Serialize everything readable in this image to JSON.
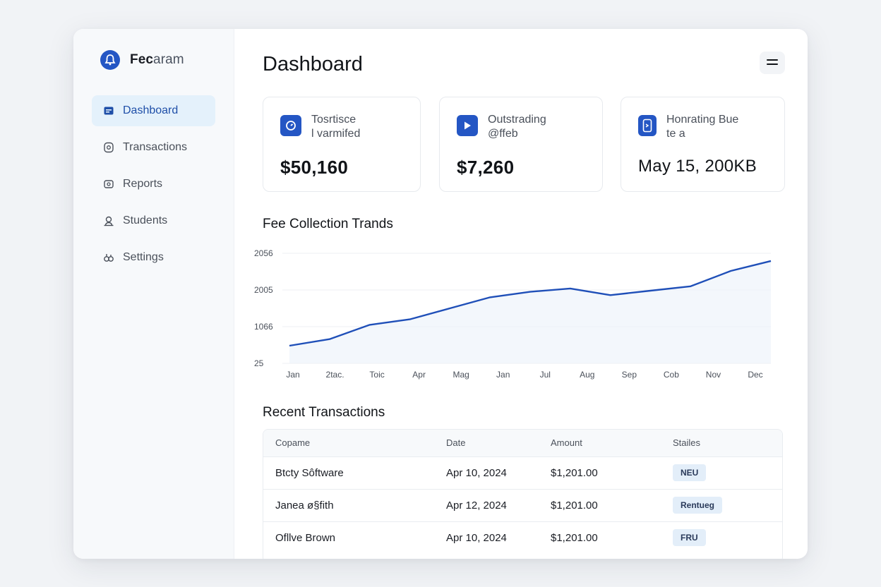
{
  "brand": {
    "name_bold": "Fec",
    "name_rest": "aram"
  },
  "nav": [
    {
      "label": "Dashboard",
      "icon": "wallet-icon",
      "active": true
    },
    {
      "label": "Transactions",
      "icon": "receipt-icon"
    },
    {
      "label": "Reports",
      "icon": "report-icon"
    },
    {
      "label": "Students",
      "icon": "user-icon"
    },
    {
      "label": "Settings",
      "icon": "gear-icon"
    }
  ],
  "page_title": "Dashboard",
  "cards": [
    {
      "label_line1": "Tosrtisce",
      "label_line2": "l varmifed",
      "value": "$50,160",
      "icon": "clock-icon"
    },
    {
      "label_line1": "Outstrading",
      "label_line2": "@ffeb",
      "value": "$7,260",
      "icon": "play-icon"
    },
    {
      "label_line1": "Honrating Bue",
      "label_line2": "te a",
      "value": "May 15, 200KB",
      "icon": "tablet-icon"
    }
  ],
  "chart_title": "Fee Collection Trands",
  "chart_data": {
    "type": "area",
    "categories": [
      "Jan",
      "2tac.",
      "Toic",
      "Apr",
      "Mag",
      "Jan",
      "Jul",
      "Aug",
      "Sep",
      "Cob",
      "Nov",
      "Dec"
    ],
    "ytick_labels": [
      "2056",
      "2005",
      "1066",
      "25"
    ],
    "y_series_fraction": [
      0.16,
      0.22,
      0.35,
      0.4,
      0.5,
      0.6,
      0.65,
      0.68,
      0.62,
      0.66,
      0.7,
      0.84,
      0.93
    ],
    "line_color": "#1f4fb8",
    "fill_color": "#eef3fb",
    "grid": true
  },
  "transactions_title": "Recent Transactions",
  "table": {
    "headers": [
      "Copame",
      "Date",
      "Amount",
      "Stailes"
    ],
    "rows": [
      {
        "name": "Btcty Sôftware",
        "date": "Apr 10, 2024",
        "amount": "$1,201.00",
        "status": "NEU"
      },
      {
        "name": "Janea ø§fith",
        "date": "Apr 12, 2024",
        "amount": "$1,201.00",
        "status": "Rentueg"
      },
      {
        "name": "Ofllve Brown",
        "date": "Apr 10, 2024",
        "amount": "$1,201.00",
        "status": "FRU"
      }
    ]
  }
}
